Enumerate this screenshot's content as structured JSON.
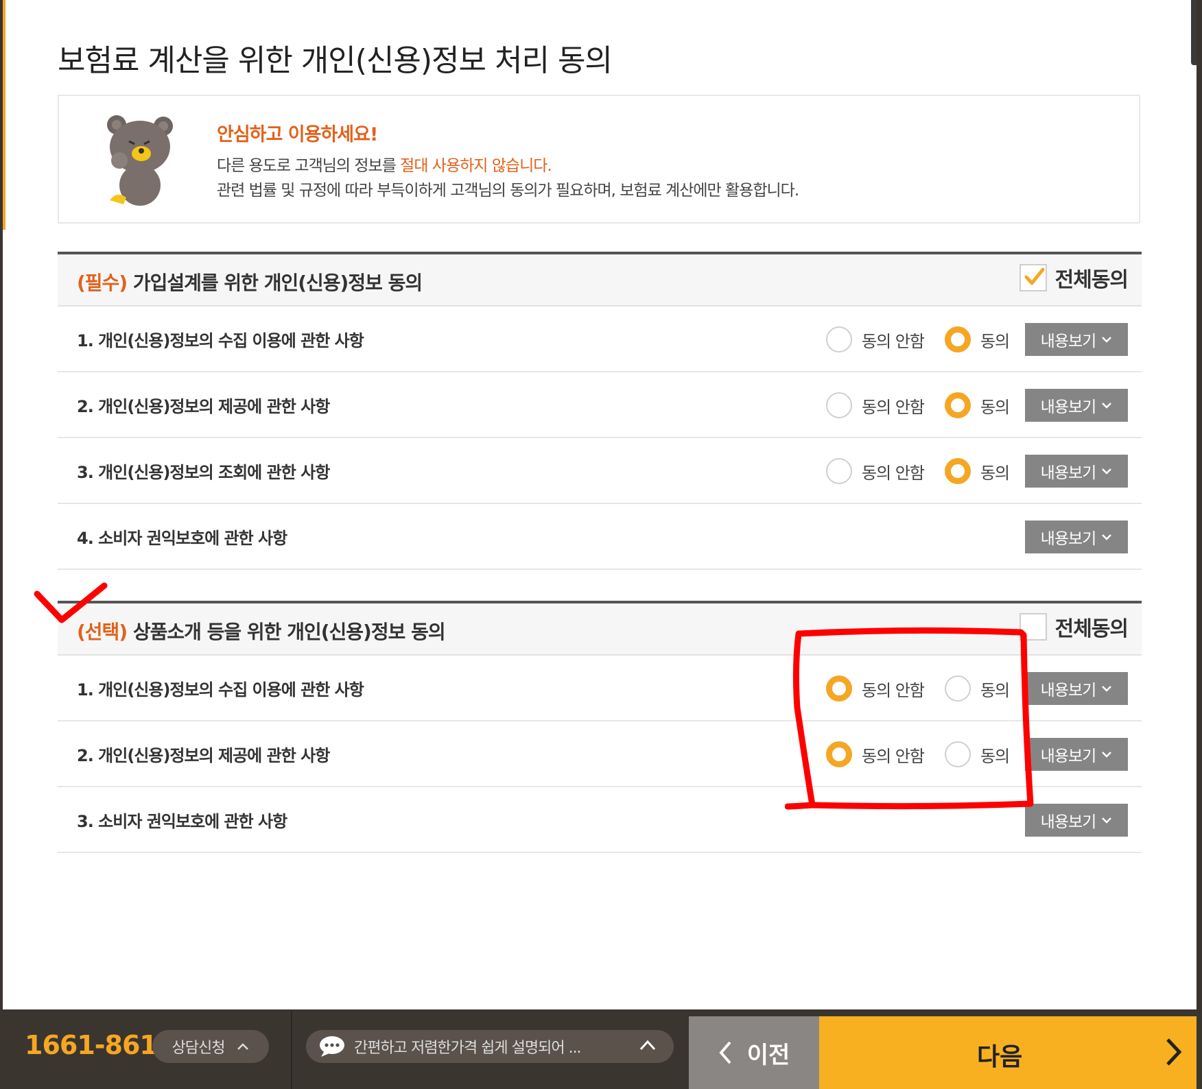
{
  "title": "보험료 계산을 위한 개인(신용)정보 처리 동의",
  "notice": {
    "heading": "안심하고 이용하세요!",
    "line1_prefix": "다른 용도로 고객님의 정보를 ",
    "line1_highlight": "절대 사용하지 않습니다.",
    "line2": "관련 법률 및 규정에 따라 부득이하게 고객님의 동의가 필요하며, 보험료 계산에만 활용합니다."
  },
  "required_section": {
    "tag": "(필수)",
    "title": " 가입설계를 위한 개인(신용)정보 동의",
    "all_agree_label": "전체동의",
    "all_agree_checked": true,
    "items": [
      {
        "label": "1. 개인(신용)정보의 수집 이용에 관한 사항",
        "disagree": "동의 안함",
        "agree": "동의",
        "selected": "agree",
        "view": "내용보기"
      },
      {
        "label": "2. 개인(신용)정보의 제공에 관한 사항",
        "disagree": "동의 안함",
        "agree": "동의",
        "selected": "agree",
        "view": "내용보기"
      },
      {
        "label": "3. 개인(신용)정보의 조회에 관한 사항",
        "disagree": "동의 안함",
        "agree": "동의",
        "selected": "agree",
        "view": "내용보기"
      },
      {
        "label": "4. 소비자 권익보호에 관한 사항",
        "view": "내용보기"
      }
    ]
  },
  "optional_section": {
    "tag": "(선택)",
    "title": " 상품소개 등을 위한 개인(신용)정보 동의",
    "all_agree_label": "전체동의",
    "all_agree_checked": false,
    "items": [
      {
        "label": "1. 개인(신용)정보의 수집 이용에 관한 사항",
        "disagree": "동의 안함",
        "agree": "동의",
        "selected": "disagree",
        "view": "내용보기"
      },
      {
        "label": "2. 개인(신용)정보의 제공에 관한 사항",
        "disagree": "동의 안함",
        "agree": "동의",
        "selected": "disagree",
        "view": "내용보기"
      },
      {
        "label": "3. 소비자 권익보호에 관한 사항",
        "view": "내용보기"
      }
    ]
  },
  "bottom_bar": {
    "phone": "1661-8614",
    "consult_label": "상담신청",
    "chat_text": "간편하고 저렴한가격 쉽게 설명되어 ...",
    "prev_label": "이전",
    "next_label": "다음"
  },
  "colors": {
    "accent_orange": "#e2611a",
    "radio_yellow": "#f5a623",
    "next_button": "#f8b021",
    "annotation_red": "#ff0000"
  },
  "icons": [
    "bear-mascot-icon",
    "check-icon",
    "chevron-down-icon",
    "chevron-up-icon",
    "chat-bubble-icon",
    "chevron-left-icon",
    "chevron-right-icon"
  ]
}
